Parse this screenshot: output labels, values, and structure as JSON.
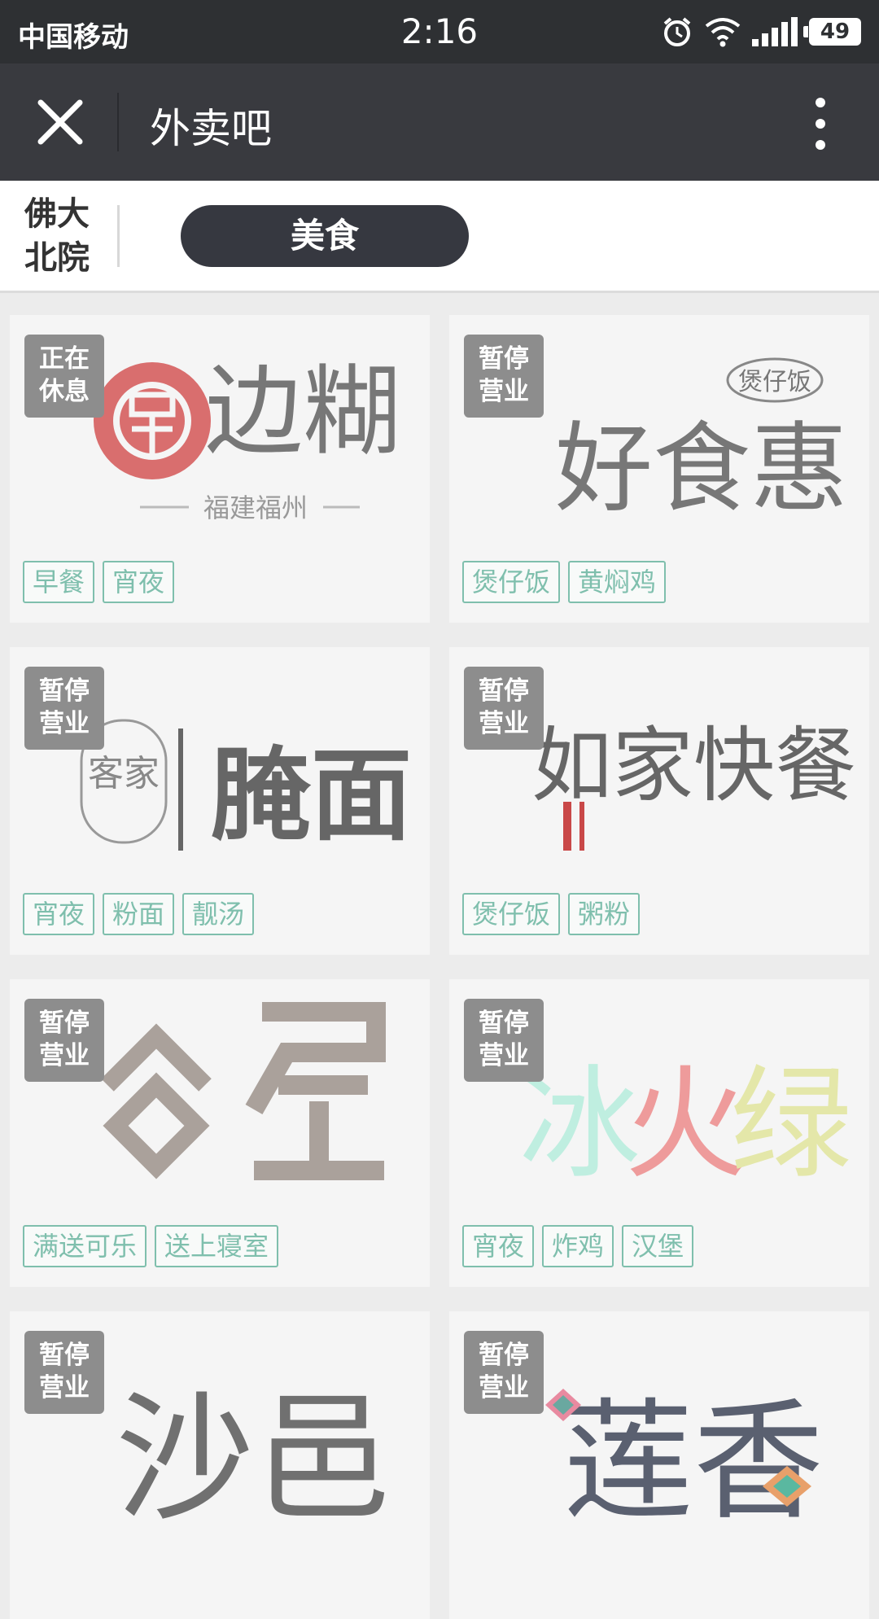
{
  "statusbar": {
    "carrier": "中国移动",
    "time": "2:16",
    "battery": "49",
    "icons": [
      "alarm-icon",
      "wifi-icon",
      "signal-icon",
      "battery-icon"
    ]
  },
  "navbar": {
    "title": "外卖吧",
    "close_icon": "close-icon",
    "more_icon": "more-vertical-icon"
  },
  "category_bar": {
    "campus": [
      "佛大",
      "北院"
    ],
    "selected_category": "美食"
  },
  "shops": [
    {
      "status_lines": [
        "正在",
        "休息"
      ],
      "logo_text": "边糊",
      "logo_sub": "福建福州",
      "tags": [
        "早餐",
        "宵夜"
      ]
    },
    {
      "status_lines": [
        "暂停",
        "营业"
      ],
      "logo_text": "好食惠",
      "logo_sub": "煲仔饭",
      "tags": [
        "煲仔饭",
        "黄焖鸡"
      ]
    },
    {
      "status_lines": [
        "暂停",
        "营业"
      ],
      "logo_text": "腌面",
      "logo_sub": "客家",
      "tags": [
        "宵夜",
        "粉面",
        "靓汤"
      ]
    },
    {
      "status_lines": [
        "暂停",
        "营业"
      ],
      "logo_text": "如家快餐",
      "logo_sub": "",
      "tags": [
        "煲仔饭",
        "粥粉"
      ]
    },
    {
      "status_lines": [
        "暂停",
        "营业"
      ],
      "logo_text": "谷屋",
      "logo_sub": "",
      "tags": [
        "满送可乐",
        "送上寝室"
      ]
    },
    {
      "status_lines": [
        "暂停",
        "营业"
      ],
      "logo_text": "冰火绿",
      "logo_sub": "",
      "tags": [
        "宵夜",
        "炸鸡",
        "汉堡"
      ]
    },
    {
      "status_lines": [
        "暂停",
        "营业"
      ],
      "logo_text": "沙邑",
      "logo_sub": "",
      "tags": []
    },
    {
      "status_lines": [
        "暂停",
        "营业"
      ],
      "logo_text": "莲香",
      "logo_sub": "",
      "tags": []
    }
  ],
  "colors": {
    "statusbar": "#2e3033",
    "navbar": "#393a3f",
    "pill": "#363840",
    "badge": "#8d8d8d",
    "tag": "#7fbfad"
  }
}
